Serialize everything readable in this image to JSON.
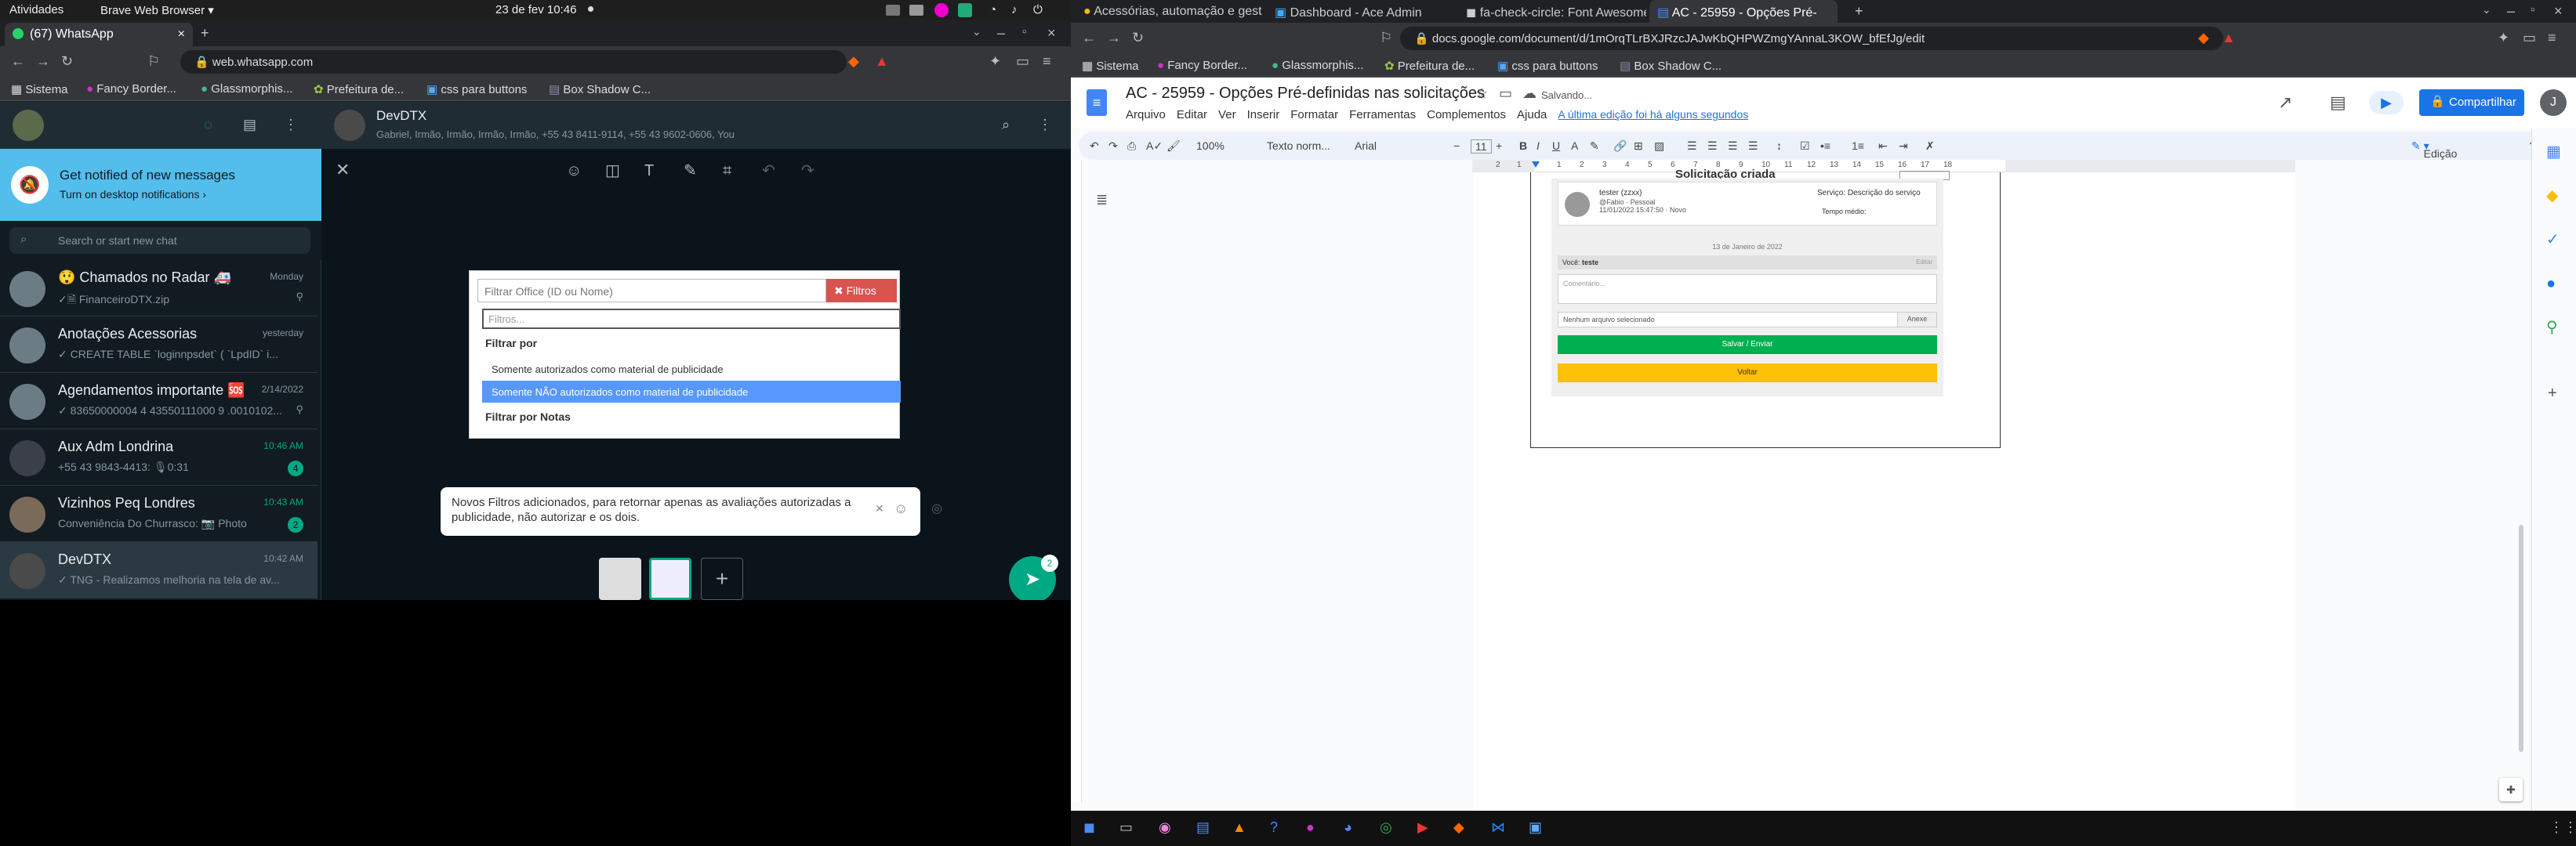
{
  "system": {
    "activities": "Atividades",
    "app": "Brave Web Browser ▾",
    "datetime": "23 de fev  10:46"
  },
  "left_browser": {
    "tab_title": "(67) WhatsApp",
    "url": "web.whatsapp.com",
    "bookmarks": [
      "Sistema",
      "Fancy Border...",
      "Glassmorphis...",
      "Prefeitura de...",
      "css para buttons",
      "Box Shadow C..."
    ]
  },
  "whatsapp": {
    "notify_title": "Get notified of new messages",
    "notify_link": "Turn on desktop notifications ›",
    "search_placeholder": "Search or start new chat",
    "chats": [
      {
        "name": "😲 Chamados no Radar 🚑",
        "preview": "✓🗎 FinanceiroDTX.zip",
        "time": "Monday",
        "badge": ""
      },
      {
        "name": "Anotações Acessorias",
        "preview": "✓ CREATE TABLE `loginnpsdet` ( `LpdID` i...",
        "time": "yesterday",
        "badge": ""
      },
      {
        "name": "Agendamentos importante 🆘",
        "preview": "✓ 83650000004 4 43550111000 9 .0010102...",
        "time": "2/14/2022",
        "badge": ""
      },
      {
        "name": "Aux Adm Londrina",
        "preview": "+55 43 9843-4413: 🎙0:31",
        "time": "10:46 AM",
        "badge": "4"
      },
      {
        "name": "Vizinhos Peq Londres",
        "preview": "Conveniência Do Churrasco: 📷 Photo",
        "time": "10:43 AM",
        "badge": "2"
      },
      {
        "name": "DevDTX",
        "preview": "✓ TNG - Realizamos melhoria na tela de av...",
        "time": "10:42 AM",
        "badge": ""
      }
    ],
    "header_name": "DevDTX",
    "header_members": "Gabriel, Irmão, Irmão, Irmão, Irmão, +55 43 8411-9114, +55 43 9602-0606, You",
    "filter_placeholder": "Filtrar Office (ID ou Nome)",
    "filter_button": "✖ Filtros",
    "filter_input_placeholder": "Filtros...",
    "filter_group1": "Filtrar por",
    "filter_opt1": "Somente autorizados como material de publicidade",
    "filter_opt2": "Somente NÃO autorizados como material de publicidade",
    "filter_group2": "Filtrar por Notas",
    "caption": "Novos Filtros adicionados, para retornar apenas as avaliações autorizadas a publicidade, não autorizar e os dois.",
    "send_count": "2"
  },
  "right_browser": {
    "tabs": [
      "Acessórias, automação e gest",
      "Dashboard - Ace Admin",
      "fa-check-circle: Font Awesome",
      "AC - 25959 - Opções Pré-"
    ],
    "url": "docs.google.com/document/d/1mOrqTLrBXJRzcJAJwKbQHPWZmgYAnnaL3KOW_bfEfJg/edit",
    "bookmarks": [
      "Sistema",
      "Fancy Border...",
      "Glassmorphis...",
      "Prefeitura de...",
      "css para buttons",
      "Box Shadow C..."
    ]
  },
  "gdocs": {
    "title": "AC - 25959 - Opções Pré-definidas nas solicitações",
    "saving": "Salvando...",
    "menu": [
      "Arquivo",
      "Editar",
      "Ver",
      "Inserir",
      "Formatar",
      "Ferramentas",
      "Complementos",
      "Ajuda"
    ],
    "last_edit": "A última edição foi há alguns segundos",
    "share": "Compartilhar",
    "avatar": "J",
    "zoom": "100%",
    "style": "Texto norm...",
    "font": "Arial",
    "size": "11",
    "mode": "Edição",
    "ruler": [
      "2",
      "1",
      "1",
      "2",
      "3",
      "4",
      "5",
      "6",
      "7",
      "8",
      "9",
      "10",
      "11",
      "12",
      "13",
      "14",
      "15",
      "16",
      "17",
      "18"
    ],
    "doc": {
      "heading": "Solicitação criada",
      "user": "tester (zzxx)",
      "user_sub": "@Fabio · Pessoal",
      "user_date": "11/01/2022 15:47:50 · Novo",
      "service": "Serviço: Descrição do serviço",
      "tempo": "Tempo médio:",
      "date_sep": "13 de Janeiro de 2022",
      "you_label": "Você:",
      "you_text": "teste",
      "edit": "Editar",
      "comment_ph": "Comentário...",
      "file": "Nenhum arquivo selecionado",
      "attach": "Anexe",
      "save": "Salvar / Enviar",
      "back": "Voltar"
    }
  }
}
